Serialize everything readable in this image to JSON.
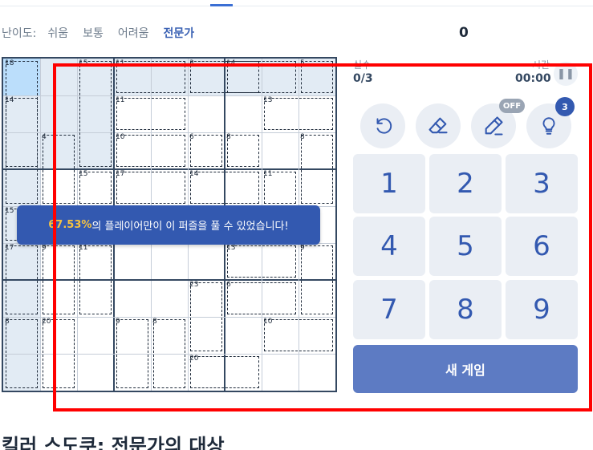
{
  "difficulty": {
    "label": "난이도:",
    "options": [
      "쉬움",
      "보통",
      "어려움",
      "전문가"
    ],
    "active_index": 3
  },
  "score": "0",
  "board": {
    "size": 9,
    "selected_cell": [
      0,
      0
    ],
    "highlighted_cells": [
      [
        0,
        1
      ],
      [
        0,
        2
      ],
      [
        0,
        3
      ],
      [
        0,
        4
      ],
      [
        0,
        5
      ],
      [
        0,
        6
      ],
      [
        0,
        7
      ],
      [
        0,
        8
      ],
      [
        1,
        0
      ],
      [
        2,
        0
      ],
      [
        3,
        0
      ],
      [
        4,
        0
      ],
      [
        5,
        0
      ],
      [
        6,
        0
      ],
      [
        7,
        0
      ],
      [
        8,
        0
      ],
      [
        1,
        1
      ],
      [
        2,
        1
      ],
      [
        1,
        2
      ],
      [
        2,
        2
      ]
    ],
    "cages": [
      {
        "sum": "18",
        "cells": [
          [
            0,
            0
          ],
          [
            1,
            0
          ],
          [
            2,
            0
          ],
          [
            3,
            0
          ]
        ]
      },
      {
        "sum": "15",
        "cells": [
          [
            0,
            2
          ],
          [
            1,
            2
          ],
          [
            2,
            2
          ]
        ]
      },
      {
        "sum": "11",
        "cells": [
          [
            0,
            3
          ],
          [
            0,
            4
          ]
        ]
      },
      {
        "sum": "3",
        "cells": [
          [
            0,
            5
          ],
          [
            0,
            6
          ]
        ]
      },
      {
        "sum": "14",
        "cells": [
          [
            0,
            6
          ],
          [
            0,
            7
          ]
        ]
      },
      {
        "sum": "5",
        "cells": [
          [
            0,
            8
          ]
        ]
      },
      {
        "sum": "14",
        "cells": [
          [
            1,
            0
          ],
          [
            2,
            0
          ]
        ]
      },
      {
        "sum": "11",
        "cells": [
          [
            1,
            3
          ],
          [
            1,
            4
          ]
        ]
      },
      {
        "sum": "13",
        "cells": [
          [
            1,
            7
          ],
          [
            1,
            8
          ]
        ]
      },
      {
        "sum": "4",
        "cells": [
          [
            2,
            1
          ],
          [
            3,
            1
          ]
        ]
      },
      {
        "sum": "10",
        "cells": [
          [
            2,
            3
          ],
          [
            2,
            4
          ]
        ]
      },
      {
        "sum": "6",
        "cells": [
          [
            2,
            5
          ]
        ]
      },
      {
        "sum": "8",
        "cells": [
          [
            2,
            6
          ]
        ]
      },
      {
        "sum": "8",
        "cells": [
          [
            2,
            8
          ],
          [
            3,
            8
          ]
        ]
      },
      {
        "sum": "15",
        "cells": [
          [
            3,
            2
          ]
        ]
      },
      {
        "sum": "17",
        "cells": [
          [
            3,
            3
          ],
          [
            3,
            4
          ]
        ]
      },
      {
        "sum": "14",
        "cells": [
          [
            3,
            5
          ],
          [
            3,
            6
          ]
        ]
      },
      {
        "sum": "11",
        "cells": [
          [
            3,
            7
          ]
        ]
      },
      {
        "sum": "15",
        "cells": [
          [
            4,
            0
          ]
        ]
      },
      {
        "sum": "17",
        "cells": [
          [
            5,
            0
          ],
          [
            6,
            0
          ]
        ]
      },
      {
        "sum": "9",
        "cells": [
          [
            5,
            1
          ],
          [
            6,
            1
          ]
        ]
      },
      {
        "sum": "11",
        "cells": [
          [
            5,
            2
          ],
          [
            6,
            2
          ]
        ]
      },
      {
        "sum": "13",
        "cells": [
          [
            5,
            6
          ],
          [
            5,
            7
          ]
        ]
      },
      {
        "sum": "9",
        "cells": [
          [
            5,
            8
          ],
          [
            6,
            8
          ]
        ]
      },
      {
        "sum": "23",
        "cells": [
          [
            6,
            5
          ],
          [
            7,
            5
          ]
        ]
      },
      {
        "sum": "6",
        "cells": [
          [
            6,
            6
          ],
          [
            6,
            7
          ]
        ]
      },
      {
        "sum": "8",
        "cells": [
          [
            7,
            0
          ],
          [
            8,
            0
          ]
        ]
      },
      {
        "sum": "20",
        "cells": [
          [
            7,
            1
          ],
          [
            8,
            1
          ]
        ]
      },
      {
        "sum": "9",
        "cells": [
          [
            7,
            3
          ],
          [
            8,
            3
          ]
        ]
      },
      {
        "sum": "8",
        "cells": [
          [
            7,
            4
          ],
          [
            8,
            4
          ]
        ]
      },
      {
        "sum": "10",
        "cells": [
          [
            7,
            7
          ],
          [
            7,
            8
          ]
        ]
      },
      {
        "sum": "20",
        "cells": [
          [
            8,
            5
          ],
          [
            8,
            6
          ]
        ]
      }
    ]
  },
  "toast": {
    "percent": "67.53%",
    "message": "의 플레이어만이 이 퍼즐을 풀 수 있었습니다!"
  },
  "stats": {
    "mistakes_label": "실수",
    "mistakes_value": "0/3",
    "time_label": "시간",
    "time_value": "00:00"
  },
  "tools": {
    "undo_icon": "undo-icon",
    "erase_icon": "eraser-icon",
    "notes_icon": "pencil-icon",
    "hint_icon": "lightbulb-icon",
    "notes_state": "OFF",
    "hints_remaining": "3"
  },
  "numpad": [
    "1",
    "2",
    "3",
    "4",
    "5",
    "6",
    "7",
    "8",
    "9"
  ],
  "new_game_label": "새 게임",
  "page_heading": "킬러 스도쿠: 전문가의 대상",
  "colors": {
    "accent": "#3359b0",
    "highlight": "#e2ebf4",
    "selected": "#bbdefb",
    "annotation": "#ff0000"
  }
}
